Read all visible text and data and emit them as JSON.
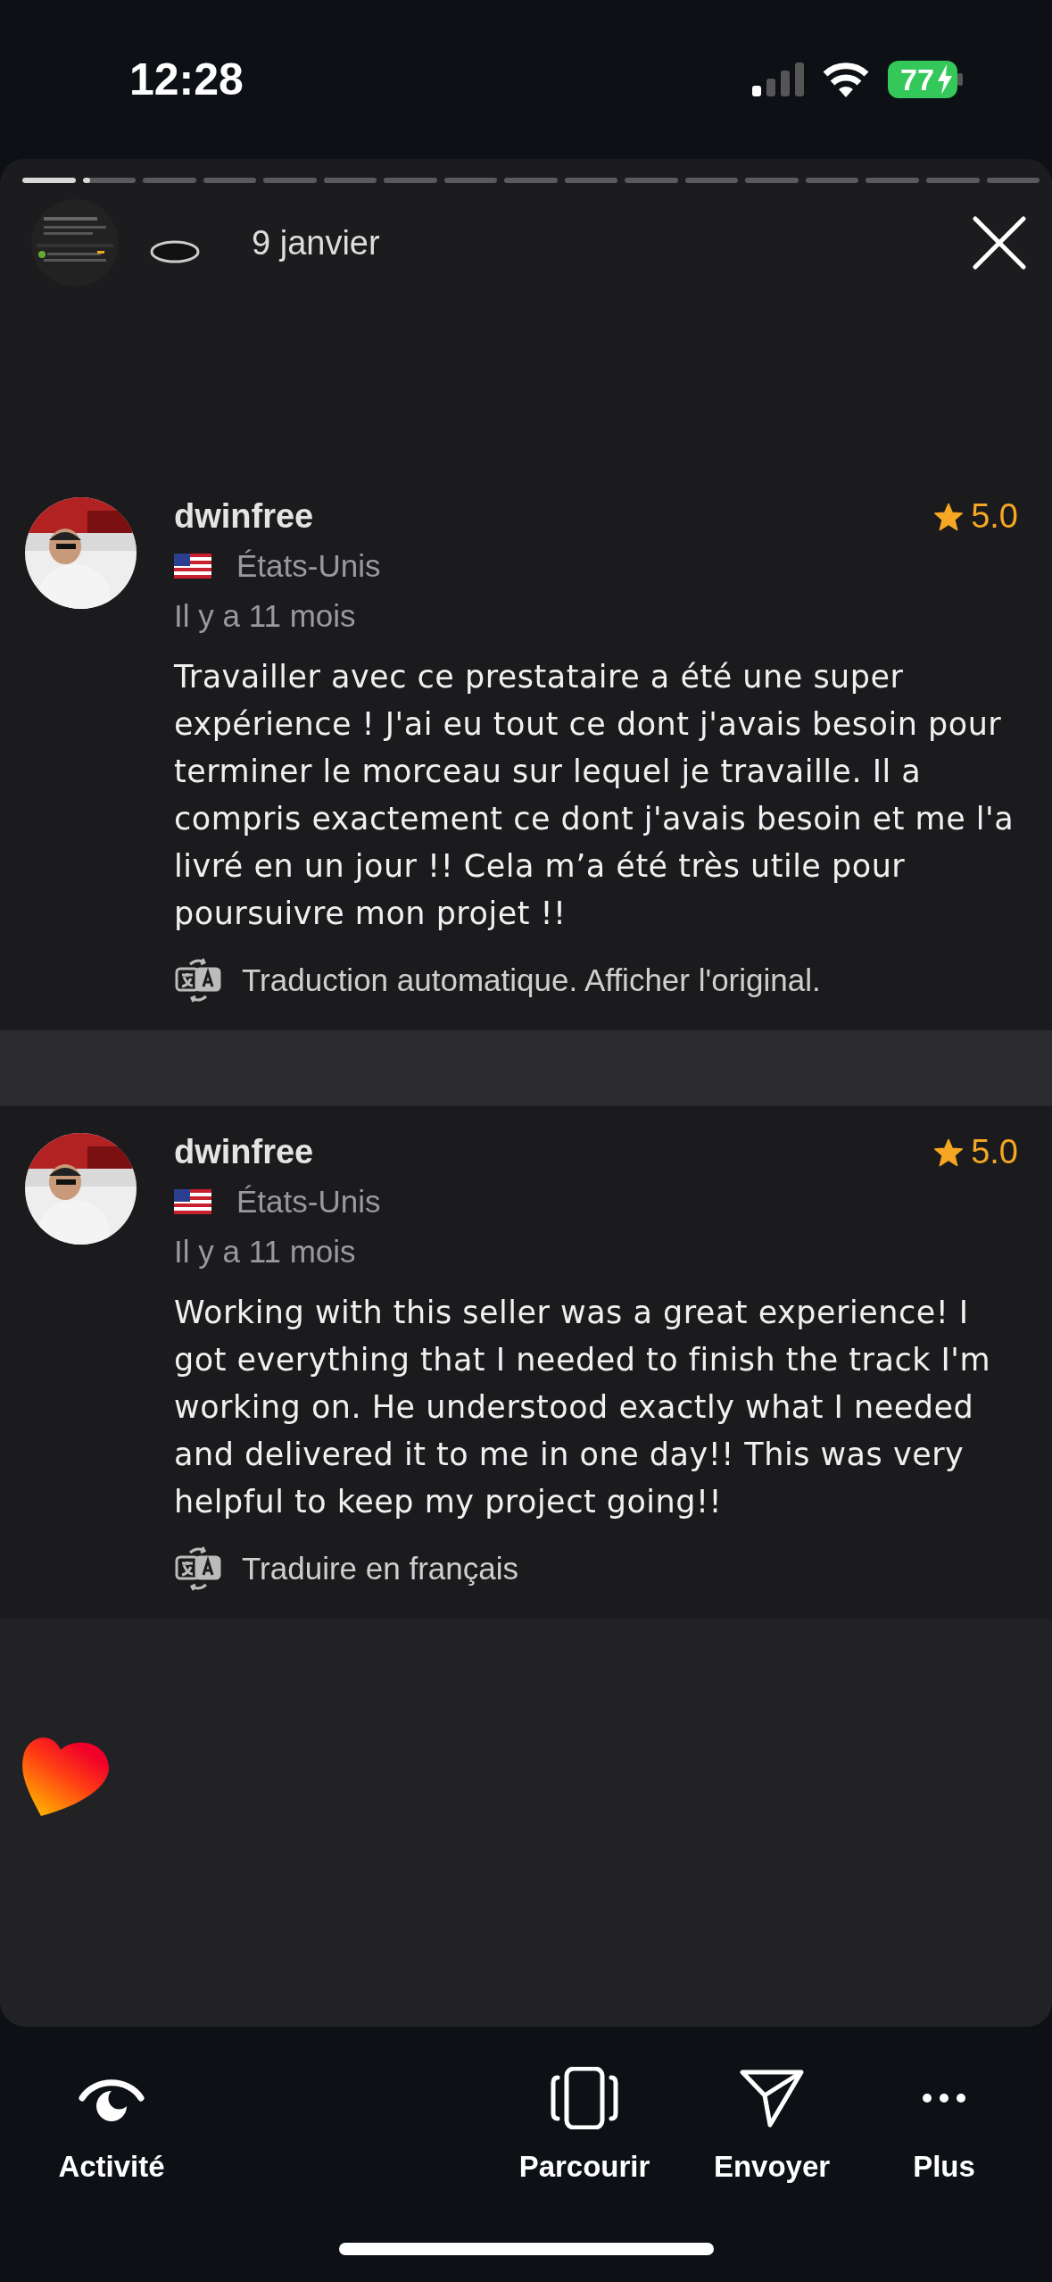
{
  "status_bar": {
    "time": "12:28",
    "battery": "77"
  },
  "story": {
    "progress": [
      {
        "level": 1
      },
      {
        "level": 0.15
      },
      {
        "level": 0
      },
      {
        "level": 0
      },
      {
        "level": 0
      },
      {
        "level": 0
      },
      {
        "level": 0
      },
      {
        "level": 0
      },
      {
        "level": 0
      },
      {
        "level": 0
      },
      {
        "level": 0
      },
      {
        "level": 0
      },
      {
        "level": 0
      },
      {
        "level": 0
      },
      {
        "level": 0
      },
      {
        "level": 0
      },
      {
        "level": 0
      }
    ],
    "date": "9 janvier"
  },
  "reviews": [
    {
      "username": "dwinfree",
      "rating": "5.0",
      "country": "États-Unis",
      "time_ago": "Il y a 11 mois",
      "text": "Travailler avec ce prestataire a été une super expérience ! J'ai eu tout ce dont j'avais besoin pour terminer le morceau sur lequel je travaille. Il a compris exactement ce dont j'avais besoin et me l'a livré en un jour !! Cela m’a été très utile pour poursuivre mon projet !!",
      "translate_link": "Traduction automatique. Afficher l'original."
    },
    {
      "username": "dwinfree",
      "rating": "5.0",
      "country": "États-Unis",
      "time_ago": "Il y a 11 mois",
      "text": "Working with this seller was a great experience! I got everything that I needed to finish the track I'm working on. He understood exactly what I needed and delivered it to me in one day!! This was very helpful to keep my project going!!",
      "translate_link": "Traduire en français"
    }
  ],
  "bottom_nav": [
    {
      "kind": "eye",
      "label": "Activité"
    },
    {
      "kind": "browse",
      "label": "Parcourir"
    },
    {
      "kind": "send",
      "label": "Envoyer"
    },
    {
      "kind": "more",
      "label": "Plus"
    }
  ]
}
